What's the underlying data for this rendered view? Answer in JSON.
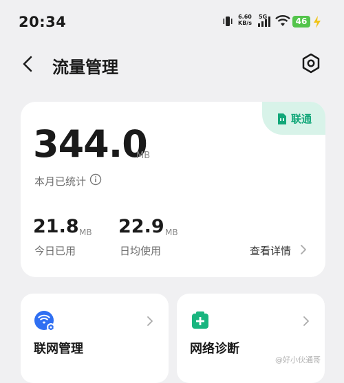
{
  "status_bar": {
    "time": "20:34",
    "net_speed_value": "6.60",
    "net_speed_unit": "KB/s",
    "signal_label": "5G",
    "battery": "46"
  },
  "header": {
    "title": "流量管理"
  },
  "usage_card": {
    "carrier": "联通",
    "month_value": "344.0",
    "month_unit": "MB",
    "month_label": "本月已统计",
    "today_value": "21.8",
    "today_unit": "MB",
    "today_label": "今日已用",
    "avg_value": "22.9",
    "avg_unit": "MB",
    "avg_label": "日均使用",
    "detail_link": "查看详情"
  },
  "tiles": [
    {
      "label": "联网管理",
      "icon": "network-management-icon"
    },
    {
      "label": "网络诊断",
      "icon": "network-diagnosis-icon"
    }
  ],
  "watermark": "@好小伙通哥",
  "colors": {
    "accent_green": "#12a779",
    "carrier_bg": "#d8f3e9",
    "blue_icon": "#2f6ff2",
    "battery": "#53c44b"
  }
}
